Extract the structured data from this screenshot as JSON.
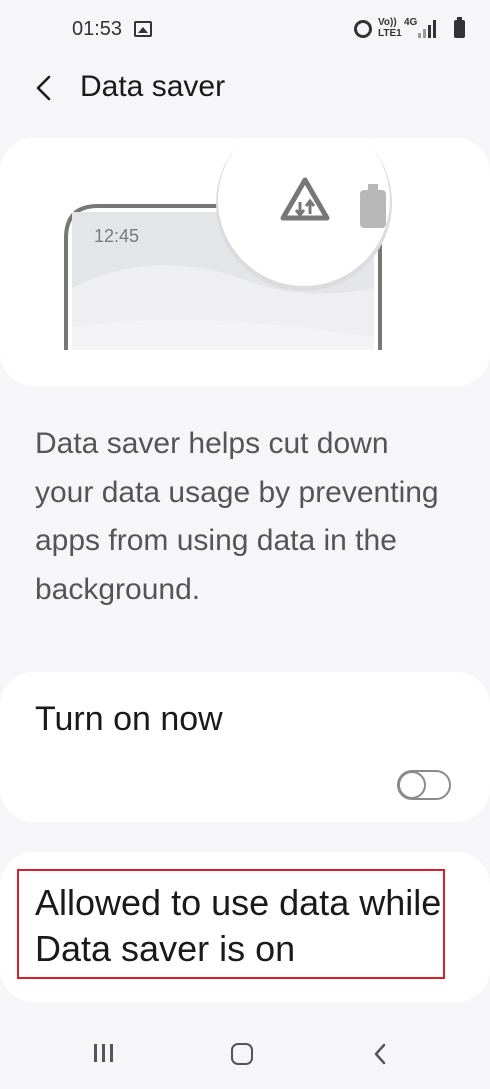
{
  "status_bar": {
    "time": "01:53",
    "network_top": "Vo))",
    "network_bottom": "LTE1",
    "network_type": "4G",
    "icons": [
      "image-icon",
      "alarm-icon",
      "signal-icon",
      "battery-icon"
    ]
  },
  "header": {
    "title": "Data saver",
    "back_icon": "chevron-left-icon"
  },
  "illustration": {
    "time": "12:45",
    "icons": [
      "data-saver-icon",
      "battery-icon"
    ]
  },
  "description": "Data saver helps cut down your data usage by preventing apps from using data in the background.",
  "turn_on": {
    "label": "Turn on now",
    "enabled": false
  },
  "allowed": {
    "label": "Allowed to use data while Data saver is on",
    "highlight_color": "#d6202a"
  },
  "nav_bar": {
    "icons": [
      "recents-icon",
      "home-icon",
      "back-icon"
    ]
  }
}
